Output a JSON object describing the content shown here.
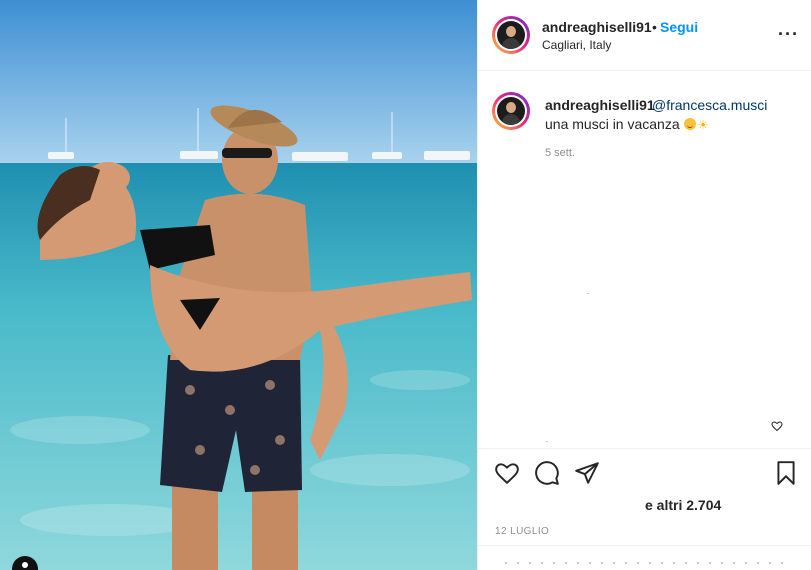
{
  "post": {
    "username": "andreaghiselli91",
    "separator": "•",
    "follow_label": "Segui",
    "location": "Cagliari, Italy",
    "more_icon": "more-horizontal-icon"
  },
  "comment": {
    "username": "andreaghiselli91",
    "mention": "@francesca.musci",
    "caption": "una musci in vacanza",
    "emojis": [
      "smiling-face-emoji",
      "sun-emoji"
    ],
    "time": "5 sett."
  },
  "actions": {
    "icons": [
      "heart-icon",
      "comment-icon",
      "share-icon",
      "bookmark-icon"
    ]
  },
  "likes_text": "e altri 2.704",
  "date": "12 LUGLIO",
  "colors": {
    "accent": "#0095f6",
    "mention": "#00376b",
    "muted": "#8e8e8e",
    "sea": "#3fb2c8",
    "sky": "#4f9fd6"
  }
}
